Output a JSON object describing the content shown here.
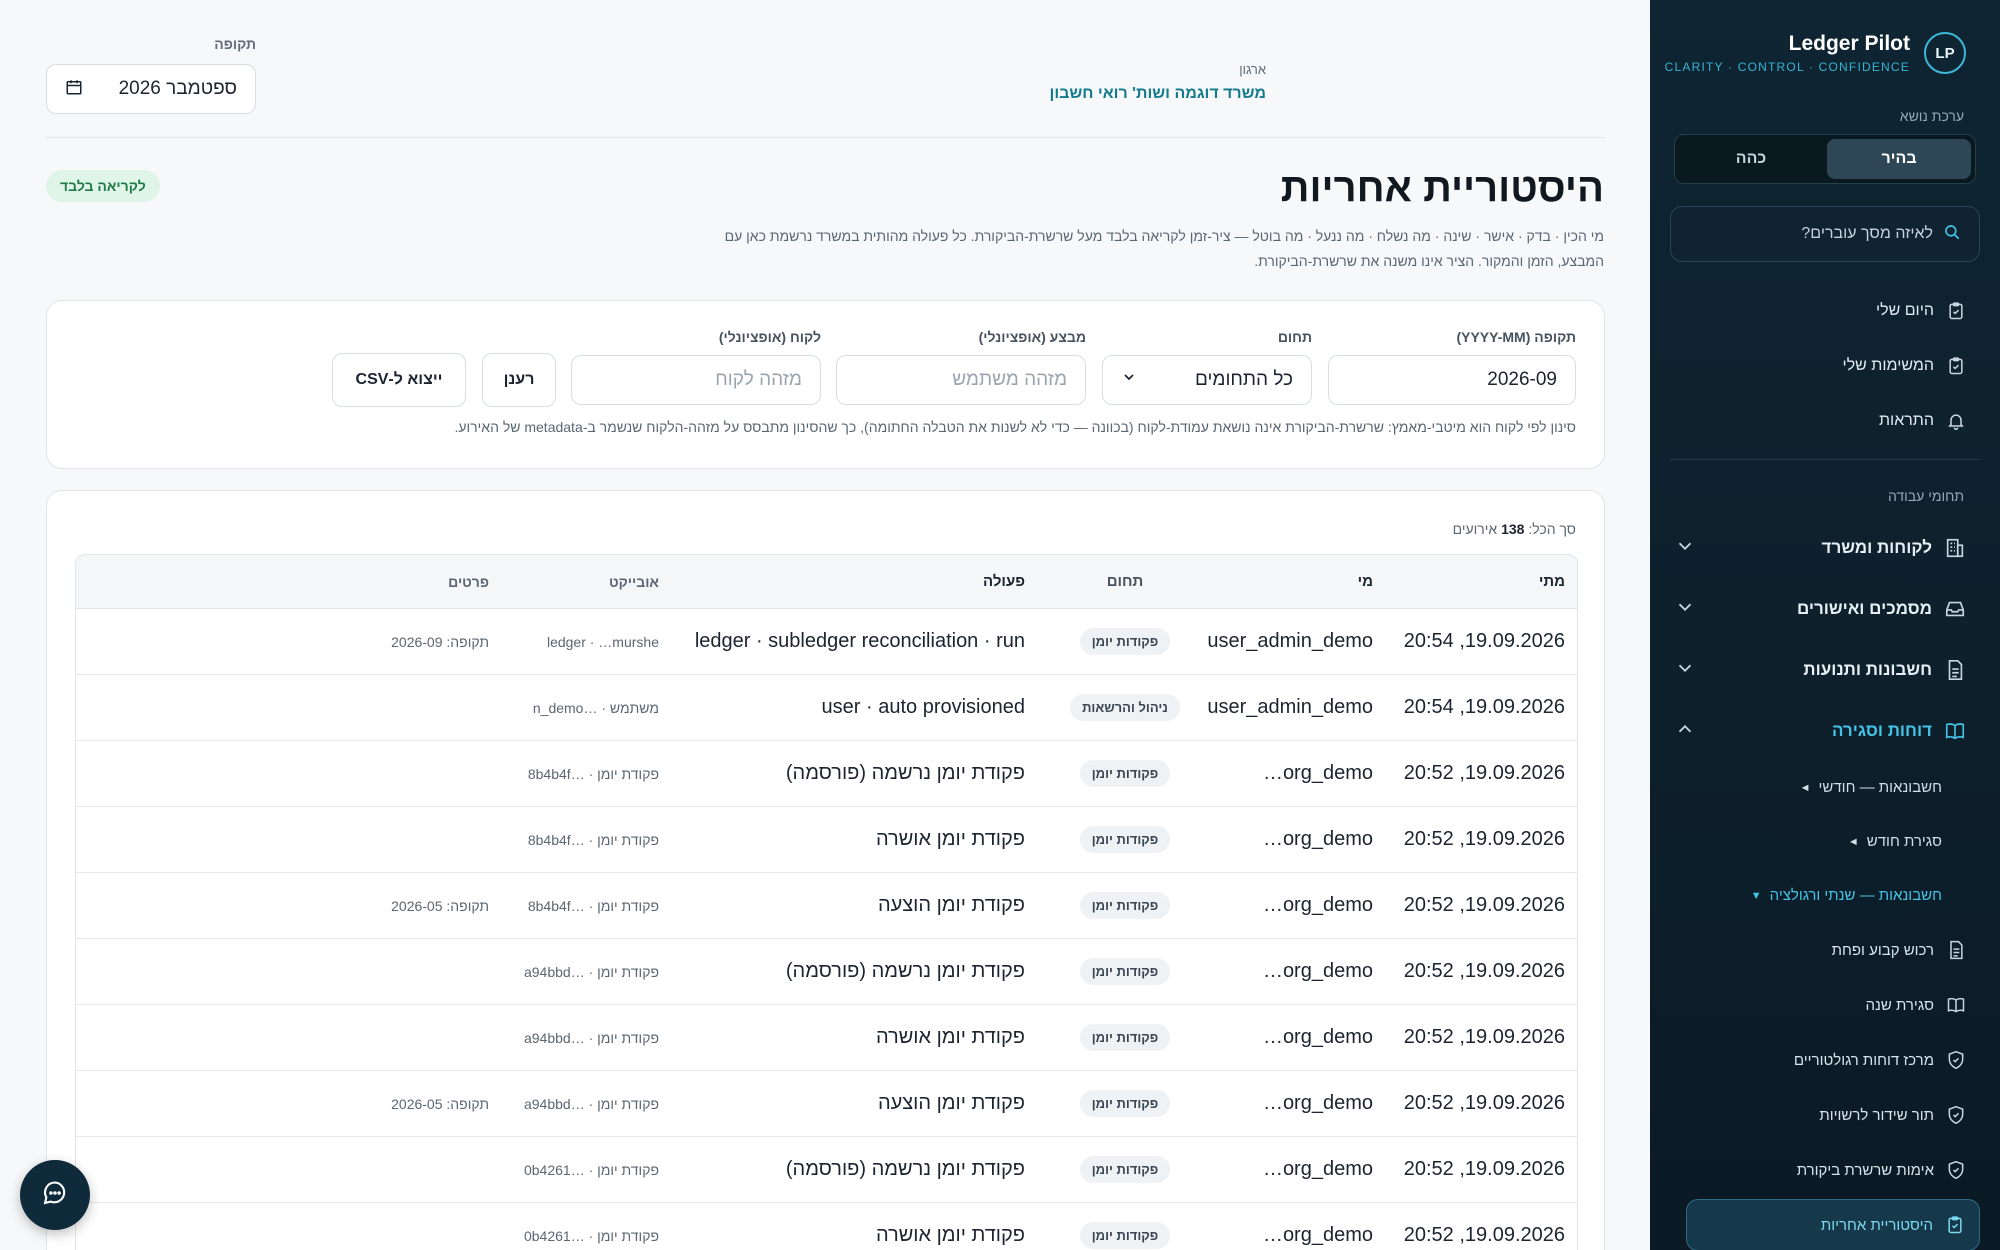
{
  "brand": {
    "name": "Ledger Pilot",
    "tagline": "CLARITY · CONTROL · CONFIDENCE",
    "logo_text": "LP"
  },
  "theme": {
    "label": "ערכת נושא",
    "light": "בהיר",
    "dark": "כהה",
    "selected": "בהיר"
  },
  "search": {
    "placeholder": "לאיזה מסך עוברים?"
  },
  "nav": {
    "top": [
      {
        "label": "היום שלי",
        "icon": "clipboard-icon"
      },
      {
        "label": "המשימות שלי",
        "icon": "clipboard-icon"
      },
      {
        "label": "התראות",
        "icon": "bell-icon"
      }
    ],
    "section_label": "תחומי עבודה",
    "groups": [
      {
        "label": "לקוחות ומשרד",
        "icon": "building-icon"
      },
      {
        "label": "מסמכים ואישורים",
        "icon": "inbox-icon"
      },
      {
        "label": "חשבונות ותנועות",
        "icon": "document-icon"
      },
      {
        "label": "דוחות וסגירה",
        "icon": "book-icon"
      }
    ],
    "subgroups": [
      {
        "label": "חשבונאות — חודשי",
        "arrow": "◄"
      },
      {
        "label": "סגירת חודש",
        "arrow": "◄"
      },
      {
        "label": "חשבונאות — שנתי ורגולציה",
        "arrow": "▼"
      }
    ],
    "subitems": [
      {
        "label": "רכוש קבוע ופחת",
        "icon": "document-icon"
      },
      {
        "label": "סגירת שנה",
        "icon": "book-icon"
      },
      {
        "label": "מרכז דוחות רגולטוריים",
        "icon": "shield-icon"
      },
      {
        "label": "תור שידור לרשויות",
        "icon": "shield-icon"
      },
      {
        "label": "אימות שרשרת ביקורת",
        "icon": "shield-icon"
      },
      {
        "label": "היסטוריית אחריות",
        "icon": "clipboard-icon"
      }
    ]
  },
  "header": {
    "org_label": "ארגון",
    "org_name": "משרד דוגמה ושות' רואי חשבון",
    "period_label": "תקופה",
    "period_value": "ספטמבר 2026"
  },
  "page": {
    "title": "היסטוריית אחריות",
    "badge": "לקריאה בלבד",
    "description": "מי הכין · בדק · אישר · שינה · מה נשלח · מה ננעל · מה בוטל — ציר-זמן לקריאה בלבד מעל שרשרת-הביקורת. כל פעולה מהותית במשרד נרשמת כאן עם המבצע, הזמן והמקור. הציר אינו משנה את שרשרת-הביקורת."
  },
  "filters": {
    "period": {
      "label": "תקופה (YYYY-MM)",
      "value": "2026-09"
    },
    "domain": {
      "label": "תחום",
      "value": "כל התחומים"
    },
    "actor": {
      "label": "מבצע (אופציונלי)",
      "placeholder": "מזהה משתמש"
    },
    "client": {
      "label": "לקוח (אופציונלי)",
      "placeholder": "מזהה לקוח"
    },
    "refresh": "רענן",
    "export": "ייצוא ל-CSV",
    "note": "סינון לפי לקוח הוא מיטבי-מאמץ: שרשרת-הביקורת אינה נושאת עמודת-לקוח (בכוונה — כדי לא לשנות את הטבלה החתומה), כך שהסינון מתבסס על מזהה-הלקוח שנשמר ב-metadata של האירוע."
  },
  "table": {
    "total_prefix": "סך הכל:",
    "total_count": "138",
    "total_suffix": "אירועים",
    "columns": {
      "when": "מתי",
      "who": "מי",
      "domain": "תחום",
      "action": "פעולה",
      "object": "אובייקט",
      "details": "פרטים"
    },
    "rows": [
      {
        "when": "19.09.2026, 20:54",
        "who": "user_admin_demo",
        "domain": "פקודות יומן",
        "action": "ledger · subledger reconciliation · run",
        "object": "ledger · …murshe",
        "details": "תקופה: 2026-09"
      },
      {
        "when": "19.09.2026, 20:54",
        "who": "user_admin_demo",
        "domain": "ניהול והרשאות",
        "action": "user · auto provisioned",
        "object": "משתמש · …n_demo",
        "details": ""
      },
      {
        "when": "19.09.2026, 20:52",
        "who": "…org_demo",
        "domain": "פקודות יומן",
        "action": "פקודת יומן נרשמה (פורסמה)",
        "object": "פקודת יומן · …8b4b4f",
        "details": ""
      },
      {
        "when": "19.09.2026, 20:52",
        "who": "…org_demo",
        "domain": "פקודות יומן",
        "action": "פקודת יומן אושרה",
        "object": "פקודת יומן · …8b4b4f",
        "details": ""
      },
      {
        "when": "19.09.2026, 20:52",
        "who": "…org_demo",
        "domain": "פקודות יומן",
        "action": "פקודת יומן הוצעה",
        "object": "פקודת יומן · …8b4b4f",
        "details": "תקופה: 2026-05"
      },
      {
        "when": "19.09.2026, 20:52",
        "who": "…org_demo",
        "domain": "פקודות יומן",
        "action": "פקודת יומן נרשמה (פורסמה)",
        "object": "פקודת יומן · …a94bbd",
        "details": ""
      },
      {
        "when": "19.09.2026, 20:52",
        "who": "…org_demo",
        "domain": "פקודות יומן",
        "action": "פקודת יומן אושרה",
        "object": "פקודת יומן · …a94bbd",
        "details": ""
      },
      {
        "when": "19.09.2026, 20:52",
        "who": "…org_demo",
        "domain": "פקודות יומן",
        "action": "פקודת יומן הוצעה",
        "object": "פקודת יומן · …a94bbd",
        "details": "תקופה: 2026-05"
      },
      {
        "when": "19.09.2026, 20:52",
        "who": "…org_demo",
        "domain": "פקודות יומן",
        "action": "פקודת יומן נרשמה (פורסמה)",
        "object": "פקודת יומן · …0b4261",
        "details": ""
      },
      {
        "when": "19.09.2026, 20:52",
        "who": "…org_demo",
        "domain": "פקודות יומן",
        "action": "פקודת יומן אושרה",
        "object": "פקודת יומן · …0b4261",
        "details": ""
      }
    ]
  },
  "colors": {
    "accent": "#44c3e6",
    "sidebar_bg": "#0f2532",
    "org_name": "#117a8b",
    "badge_bg": "#dff5e8",
    "badge_text": "#1f7a45"
  }
}
